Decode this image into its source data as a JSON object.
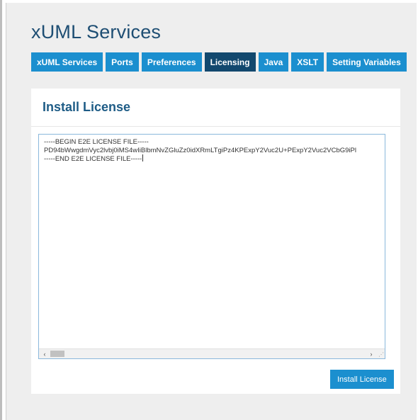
{
  "page_title": "xUML Services",
  "tabs": [
    {
      "label": "xUML Services",
      "active": false
    },
    {
      "label": "Ports",
      "active": false
    },
    {
      "label": "Preferences",
      "active": false
    },
    {
      "label": "Licensing",
      "active": true
    },
    {
      "label": "Java",
      "active": false
    },
    {
      "label": "XSLT",
      "active": false
    },
    {
      "label": "Setting Variables",
      "active": false
    }
  ],
  "install_card": {
    "title": "Install License",
    "license_text": {
      "line1": "-----BEGIN E2E LICENSE FILE-----",
      "line2": "PD94bWwgdmVyc2lvbj0iMS4wIiBlbmNvZGluZz0idXRmLTgiPz4KPExpY2Vuc2U+PExpY2Vuc2VCbG9iPl",
      "line3": "-----END E2E LICENSE FILE-----"
    },
    "scroll_left": "‹",
    "scroll_right": "›",
    "install_button_label": "Install License"
  },
  "colors": {
    "tab": "#1b8fcf",
    "tab_active": "#12486e",
    "title": "#1e4e73",
    "button": "#1b8fcf"
  }
}
